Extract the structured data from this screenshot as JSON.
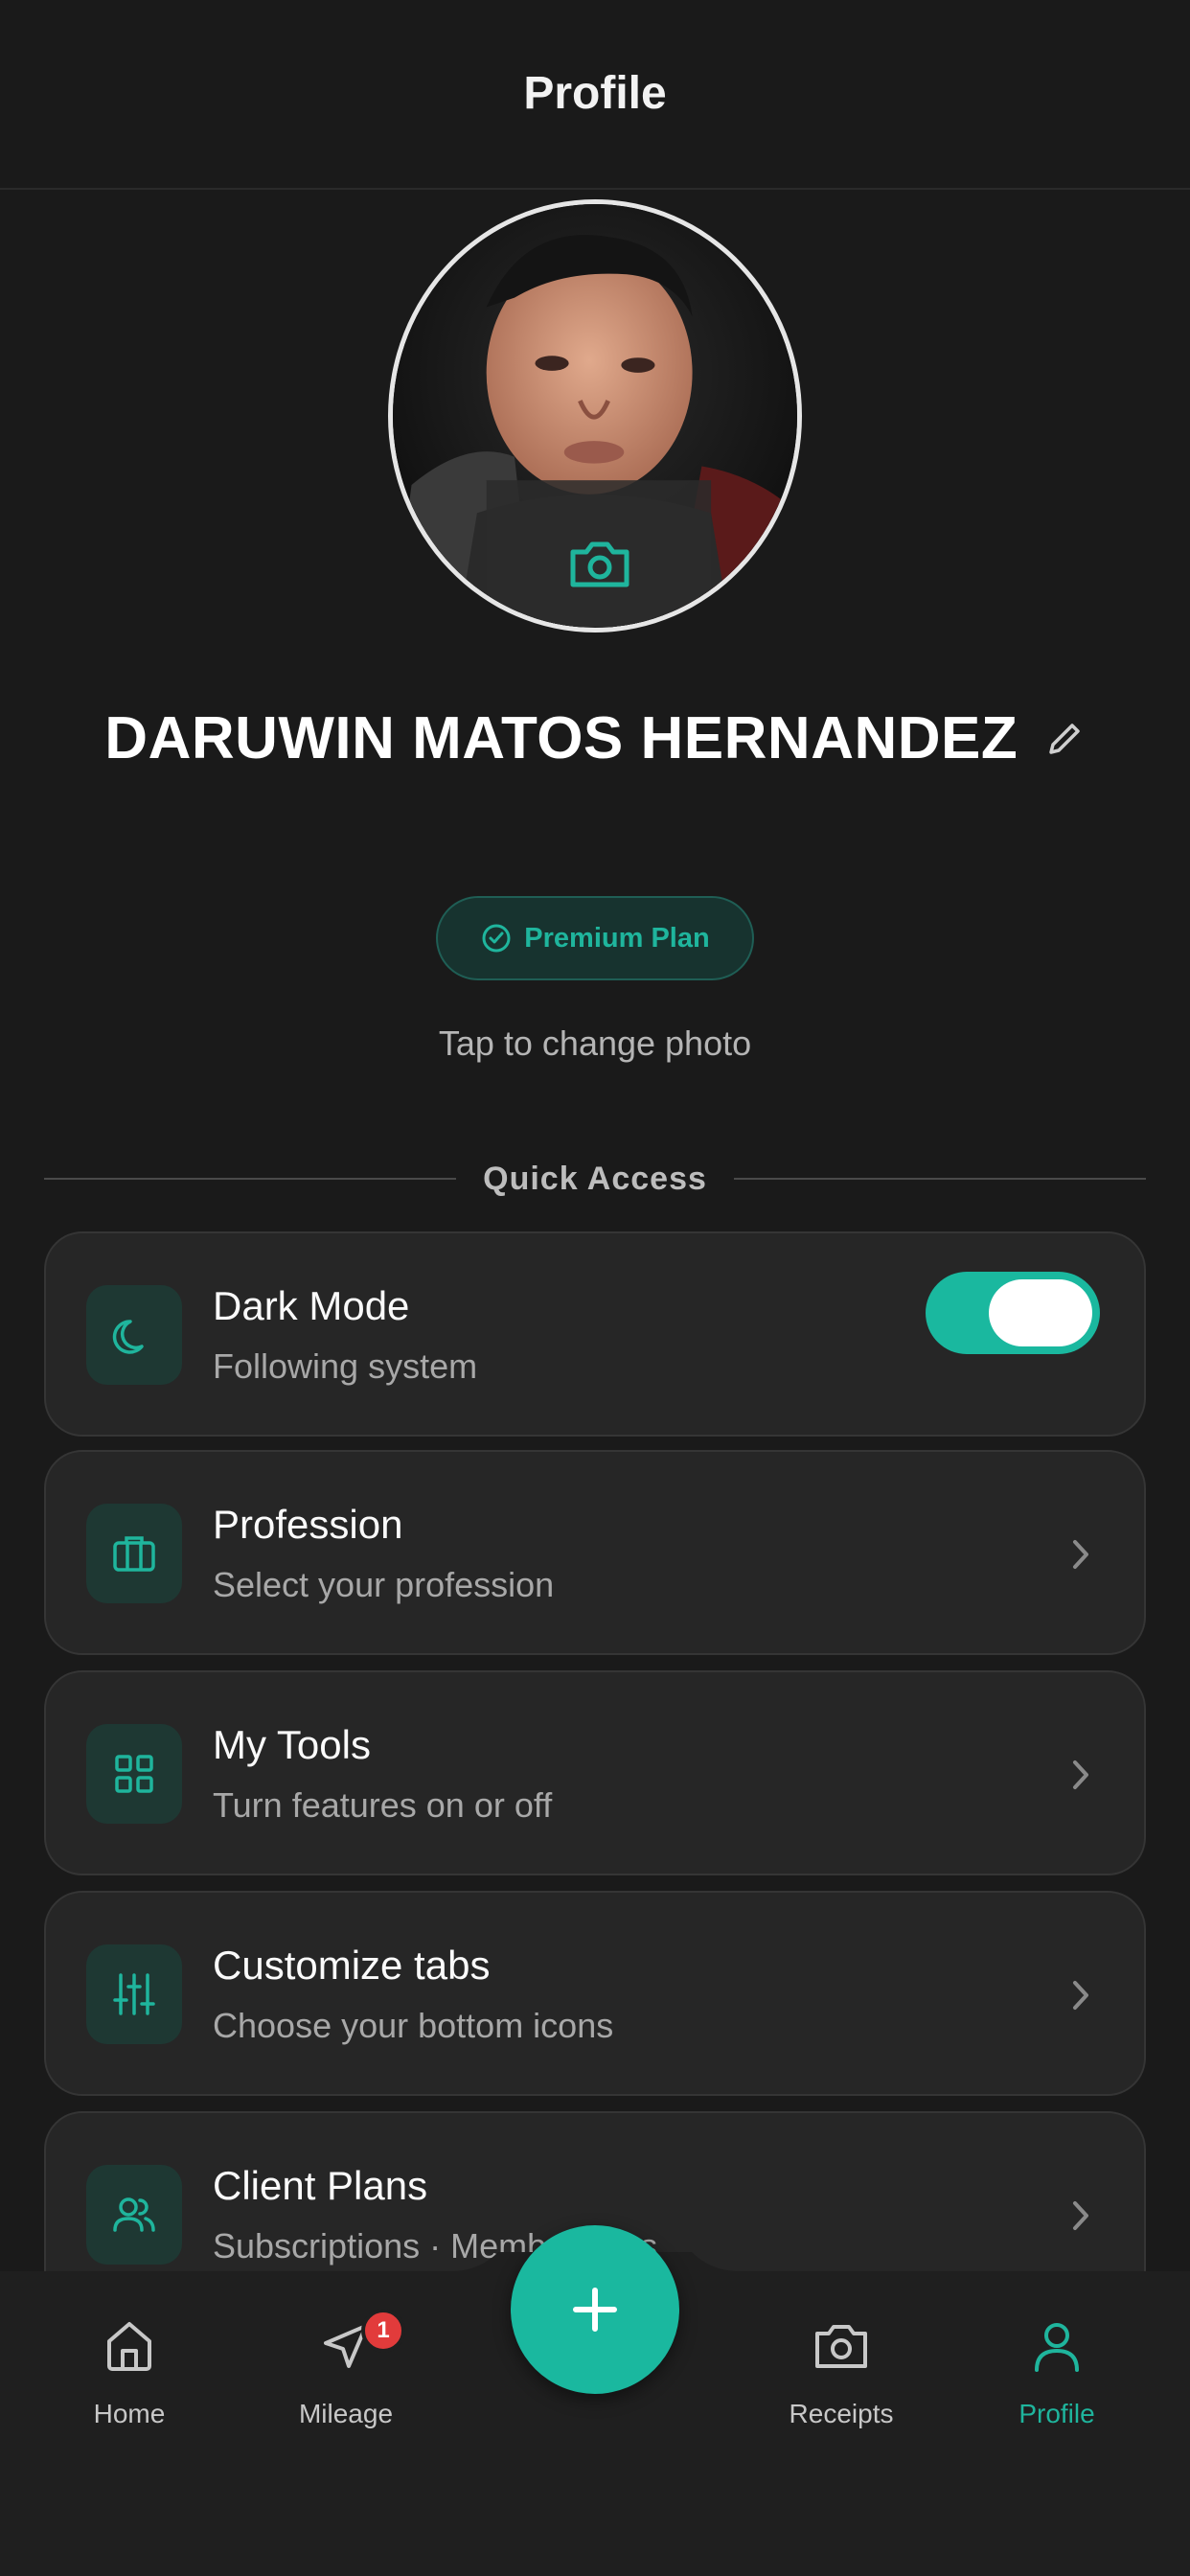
{
  "header": {
    "title": "Profile"
  },
  "profile": {
    "name": "DARUWIN MATOS HERNANDEZ",
    "plan_label": "Premium Plan",
    "tap_hint": "Tap to change photo"
  },
  "section": {
    "label": "Quick Access"
  },
  "cards": [
    {
      "title": "Dark Mode",
      "subtitle": "Following system",
      "icon": "moon-icon",
      "toggle_on": true
    },
    {
      "title": "Profession",
      "subtitle": "Select your profession",
      "icon": "briefcase-icon"
    },
    {
      "title": "My Tools",
      "subtitle": "Turn features on or off",
      "icon": "grid-icon"
    },
    {
      "title": "Customize tabs",
      "subtitle": "Choose your bottom icons",
      "icon": "sliders-icon"
    },
    {
      "title": "Client Plans",
      "subtitle": "Subscriptions · Memberships",
      "icon": "users-icon"
    }
  ],
  "tabbar": {
    "tabs": [
      {
        "label": "Home",
        "icon": "home-icon"
      },
      {
        "label": "Mileage",
        "icon": "navigation-icon",
        "badge": "1"
      },
      {
        "label": "Receipts",
        "icon": "camera-icon"
      },
      {
        "label": "Profile",
        "icon": "user-icon",
        "active": true
      }
    ],
    "fab_icon": "plus-icon"
  },
  "colors": {
    "accent": "#1ab89f",
    "background": "#1a1a1a",
    "card": "#262626",
    "badge": "#e23b3b"
  }
}
